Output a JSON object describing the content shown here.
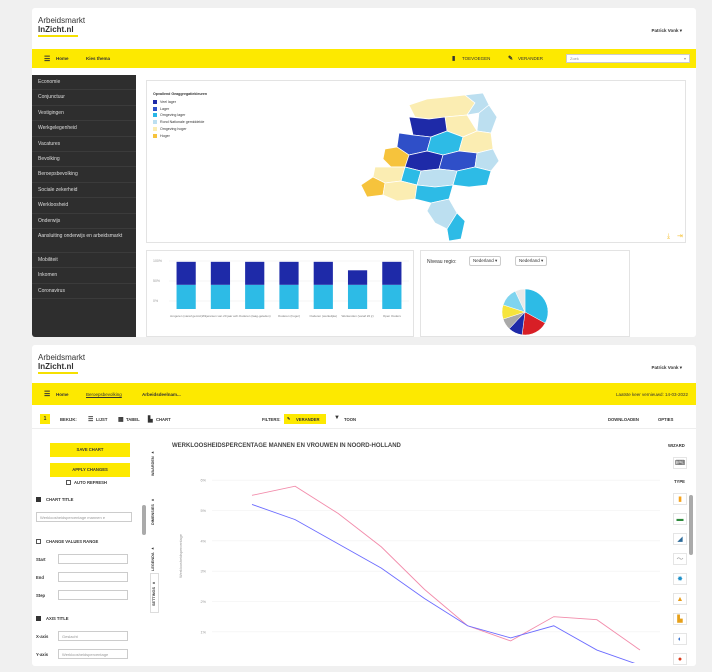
{
  "top": {
    "logo_line1": "Arbeidsmarkt",
    "logo_line2": "InZicht.nl",
    "user": "Patrick Vonk",
    "home": "Home",
    "choose_theme": "Kies thema",
    "add": "TOEVOEGEN",
    "change": "VERANDER",
    "search_placeholder": "Zoek",
    "sidebar": [
      "Economie",
      "Conjunctuur",
      "Vestigingen",
      "Werkgelegenheid",
      "Vacatures",
      "Bevolking",
      "Beroepsbevolking",
      "Sociale zekerheid",
      "Werkloosheid",
      "Onderwijs",
      "Aansluiting onderwijs en arbeidsmarkt",
      "Mobiliteit",
      "Inkomen",
      "Coronavirus"
    ],
    "map_legend": {
      "title": "Opvallend Geaggregatiekleuren",
      "items": [
        {
          "label": "Veel lager",
          "color": "#1e2aa8"
        },
        {
          "label": "Lager",
          "color": "#2f4fc8"
        },
        {
          "label": "Omgeving lager",
          "color": "#29b6e6"
        },
        {
          "label": "Rond Nationale gemiddelde",
          "color": "#bcdff0"
        },
        {
          "label": "Omgeving hoger",
          "color": "#fbedb2"
        },
        {
          "label": "Hoger",
          "color": "#f6c33c"
        }
      ]
    },
    "bar_chart": {
      "ticks": [
        "100%",
        "50%",
        "0%"
      ],
      "categories": [
        "Jongeren (vanaf gemid.)",
        "Wiijereisen van 20 jaar ach.",
        "Ouderen (laag-geleden)",
        "Ouderen (hoger)",
        "Ouderen (werkelijke)",
        "Werkenden (vanaf 20 jr)",
        "Open Ouders"
      ]
    },
    "pie": {
      "region_label": "Niveau regio:",
      "select1": "Nederland",
      "select2": "Nederland"
    }
  },
  "chart_data": [
    {
      "type": "bar",
      "categories": [
        "Jongeren (vanaf gemid.)",
        "Wiijereisen van 20 jaar ach.",
        "Ouderen (laag-geleden)",
        "Ouderen (hoger)",
        "Ouderen (werkelijke)",
        "Werkenden (vanaf 20 jr)",
        "Open Ouders"
      ],
      "series": [
        {
          "name": "",
          "values": [
            40,
            40,
            40,
            40,
            40,
            40,
            40
          ],
          "color": "#2dbbe6"
        },
        {
          "name": "",
          "values": [
            38,
            38,
            38,
            38,
            38,
            24,
            38
          ],
          "color": "#1e2aa8"
        }
      ],
      "ylim": [
        0,
        100
      ]
    },
    {
      "type": "pie",
      "values": [
        33,
        19,
        10,
        8,
        10,
        13,
        7
      ],
      "colors": [
        "#2dbbe6",
        "#d81f26",
        "#1e2aa8",
        "#a9a9a9",
        "#f6e43c",
        "#7fd4ef",
        "#e9e9e9"
      ]
    },
    {
      "type": "line",
      "title": "WERKLOOSHEIDSPERCENTAGE MANNEN EN VROUWEN IN NOORD-HOLLAND",
      "ylabel": "Werkloosheidspercentage",
      "yticks": [
        "6%",
        "5%",
        "4%",
        "3%",
        "2%",
        "1%"
      ],
      "ylim": [
        0.5,
        6.5
      ],
      "series": [
        {
          "name": "",
          "color": "#f28cab",
          "values": [
            5.5,
            5.8,
            4.9,
            3.8,
            2.4,
            1.2,
            0.7,
            1.5,
            1.4,
            0.4
          ]
        },
        {
          "name": "",
          "color": "#6c6cff",
          "values": [
            5.2,
            4.7,
            3.9,
            3.1,
            2.1,
            1.2,
            0.8,
            1.2,
            0.4,
            -0.1
          ]
        }
      ]
    }
  ],
  "bottom": {
    "logo_line1": "Arbeidsmarkt",
    "logo_line2": "InZicht.nl",
    "user": "Patrick Vonk",
    "home": "Home",
    "crumb1": "Beroepsbevolking",
    "crumb2": "Arbeidsdeelnam...",
    "updated": "Laatste keer vernieuwd: 14-03-2022",
    "step": "1",
    "view_label": "BEKIJK:",
    "list": "LIJST",
    "table": "TABEL",
    "chart": "CHART",
    "filters": "FILTERS:",
    "change": "VERANDER",
    "show": "TOON",
    "download": "DOWNLOADEN",
    "options": "OPTIES",
    "save_chart": "SAVE CHART",
    "apply_changes": "APPLY CHANGES",
    "auto_refresh": "AUTO REFRESH",
    "chart_title_label": "CHART TITLE",
    "chart_title_value": "Werkloosheidspercentage mannen e",
    "change_values_label": "CHANGE VALUES RANGE",
    "start": "Start",
    "end": "End",
    "step_label": "Step",
    "axis_title": "AXIS TITLE",
    "xaxis": "X-axis",
    "xaxis_value": "Geslacht",
    "yaxis": "Y-axis",
    "yaxis_value": "Werkloosheidspercentage",
    "vtabs": [
      "WAARDEN",
      "DIMENSIES",
      "LEGENDA",
      "SETTINGS"
    ],
    "wizard": "WIZARD",
    "type": "TYPE"
  }
}
